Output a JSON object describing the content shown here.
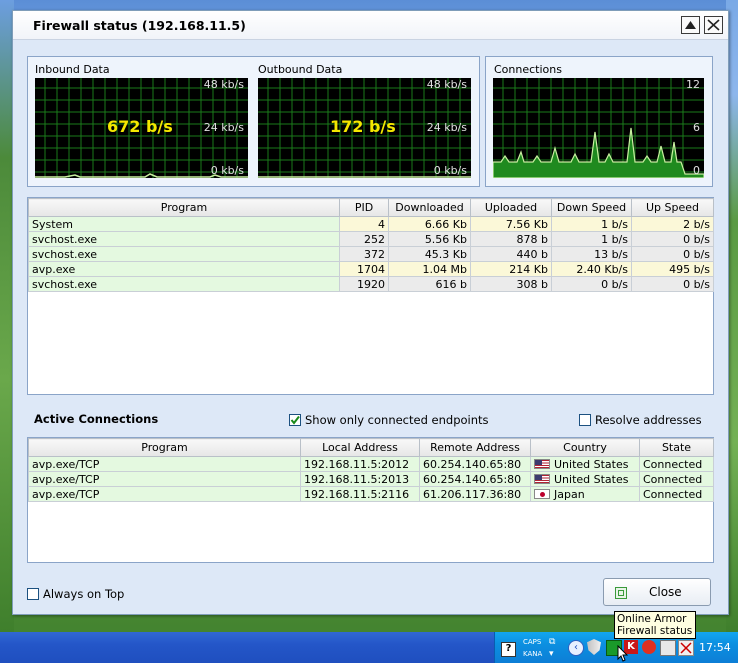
{
  "window": {
    "title": "Firewall status (192.168.11.5)"
  },
  "graphs": {
    "inbound": {
      "label": "Inbound Data",
      "value": "672 b/s",
      "scale_top": "48 kb/s",
      "scale_mid": "24 kb/s",
      "scale_bot": "0 kb/s"
    },
    "outbound": {
      "label": "Outbound Data",
      "value": "172 b/s",
      "scale_top": "48 kb/s",
      "scale_mid": "24 kb/s",
      "scale_bot": "0 kb/s"
    },
    "connections": {
      "label": "Connections",
      "scale_top": "12",
      "scale_mid": "6",
      "scale_bot": "0"
    }
  },
  "programs": {
    "headers": [
      "Program",
      "PID",
      "Downloaded",
      "Uploaded",
      "Down Speed",
      "Up Speed"
    ],
    "rows": [
      {
        "program": "System",
        "pid": "4",
        "downloaded": "6.66 Kb",
        "uploaded": "7.56 Kb",
        "down_speed": "1 b/s",
        "up_speed": "2 b/s"
      },
      {
        "program": "svchost.exe",
        "pid": "252",
        "downloaded": "5.56 Kb",
        "uploaded": "878 b",
        "down_speed": "1 b/s",
        "up_speed": "0 b/s"
      },
      {
        "program": "svchost.exe",
        "pid": "372",
        "downloaded": "45.3 Kb",
        "uploaded": "440 b",
        "down_speed": "13 b/s",
        "up_speed": "0 b/s"
      },
      {
        "program": "avp.exe",
        "pid": "1704",
        "downloaded": "1.04 Mb",
        "uploaded": "214 Kb",
        "down_speed": "2.40 Kb/s",
        "up_speed": "495 b/s"
      },
      {
        "program": "svchost.exe",
        "pid": "1920",
        "downloaded": "616 b",
        "uploaded": "308 b",
        "down_speed": "0 b/s",
        "up_speed": "0 b/s"
      }
    ]
  },
  "active": {
    "title": "Active Connections",
    "show_connected_label": "Show only connected endpoints",
    "show_connected_checked": true,
    "resolve_label": "Resolve addresses",
    "resolve_checked": false,
    "headers": [
      "Program",
      "Local Address",
      "Remote Address",
      "Country",
      "State"
    ],
    "rows": [
      {
        "program": "avp.exe/TCP",
        "local": "192.168.11.5:2012",
        "remote": "60.254.140.65:80",
        "country": "United States",
        "flag": "us",
        "state": "Connected"
      },
      {
        "program": "avp.exe/TCP",
        "local": "192.168.11.5:2013",
        "remote": "60.254.140.65:80",
        "country": "United States",
        "flag": "us",
        "state": "Connected"
      },
      {
        "program": "avp.exe/TCP",
        "local": "192.168.11.5:2116",
        "remote": "61.206.117.36:80",
        "country": "Japan",
        "flag": "jp",
        "state": "Connected"
      }
    ]
  },
  "footer": {
    "always_on_top_label": "Always on Top",
    "always_on_top_checked": false,
    "close_label": "Close"
  },
  "taskbar": {
    "caps": "CAPS",
    "kana": "KANA",
    "clock": "17:54",
    "tooltip_line1": "Online Armor",
    "tooltip_line2": "Firewall status"
  }
}
